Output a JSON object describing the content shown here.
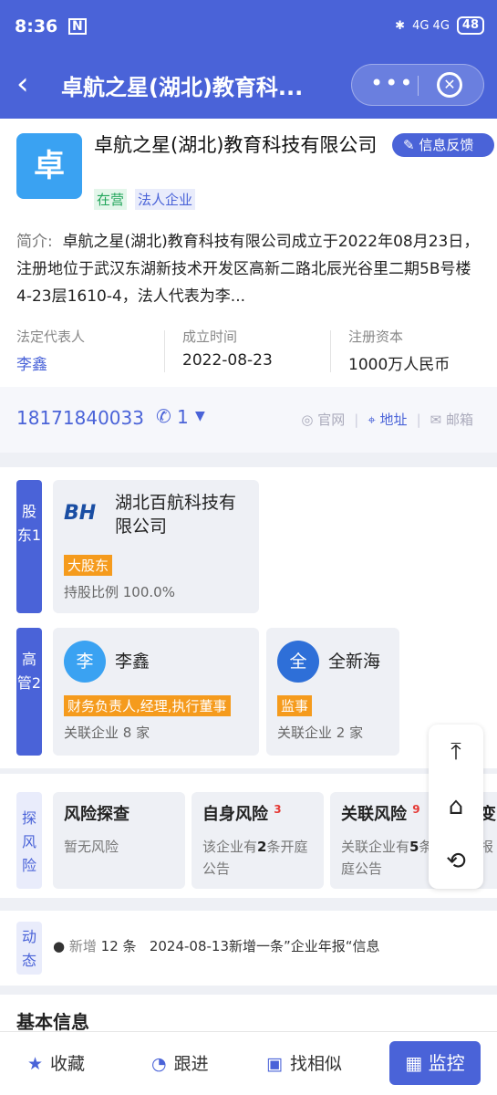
{
  "status_bar": {
    "time": "8:36",
    "sim": "N",
    "network": "4G 4G",
    "battery": "48"
  },
  "nav": {
    "title": "卓航之星(湖北)教育科...",
    "more": "•••",
    "close": "✕"
  },
  "company": {
    "logo_char": "卓",
    "name": "卓航之星(湖北)教育科技有限公司",
    "feedback": "信息反馈",
    "status_tag": "在营",
    "type_tag": "法人企业",
    "intro_label": "简介:",
    "intro": "卓航之星(湖北)教育科技有限公司成立于2022年08月23日，注册地位于武汉东湖新技术开发区高新二路北辰光谷里二期5B号楼4-23层1610-4，法人代表为李...",
    "legal_rep_label": "法定代表人",
    "legal_rep": "李鑫",
    "founded_label": "成立时间",
    "founded": "2022-08-23",
    "capital_label": "注册资本",
    "capital": "1000万人民币"
  },
  "contact": {
    "phone": "18171840033",
    "phone_count": "1",
    "website": "官网",
    "address": "地址",
    "email": "邮箱"
  },
  "shareholders": {
    "label": "股东1",
    "items": [
      {
        "name": "湖北百航科技有限公司",
        "badge": "大股东",
        "ratio": "持股比例 100.0%"
      }
    ]
  },
  "management": {
    "label": "高管2",
    "items": [
      {
        "avatar": "李",
        "name": "李鑫",
        "role": "财务负责人,经理,执行董事",
        "related": "关联企业 8 家"
      },
      {
        "avatar": "全",
        "name": "全新海",
        "role": "监事",
        "related": "关联企业 2 家"
      }
    ]
  },
  "risk": {
    "label": "探风险",
    "items": [
      {
        "title": "风险探查",
        "count": "",
        "desc": "暂无风险"
      },
      {
        "title": "自身风险",
        "count": "3",
        "desc_pre": "该企业有",
        "desc_num": "2",
        "desc_post": "条开庭公告"
      },
      {
        "title": "关联风险",
        "count": "9",
        "desc_pre": "关联企业有",
        "desc_num": "5",
        "desc_post": "条开庭公告"
      },
      {
        "title": "变",
        "count": "",
        "desc": "报"
      }
    ]
  },
  "dynamic": {
    "label": "动态",
    "new_label": "新增",
    "count": "12 条",
    "text": "2024-08-13新增一条”企业年报“信息"
  },
  "basic_info": {
    "title": "基本信息"
  },
  "bottom_bar": {
    "collect": "收藏",
    "follow": "跟进",
    "similar": "找相似",
    "monitor": "监控"
  },
  "colors": {
    "primary": "#4a63d8",
    "orange": "#f59b1d",
    "green": "#21a55a",
    "logo_blue": "#3aa2f2"
  }
}
